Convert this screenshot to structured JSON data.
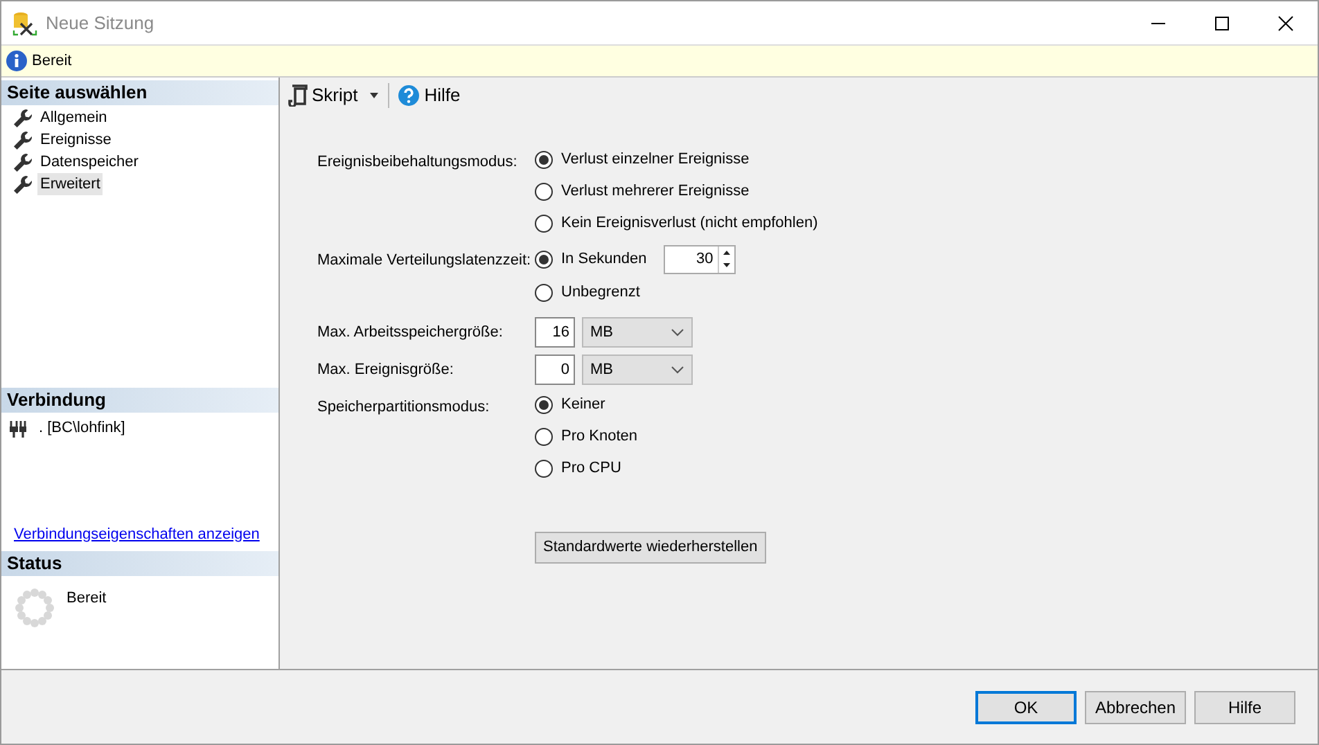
{
  "window": {
    "title": "Neue Sitzung"
  },
  "info_bar": {
    "text": "Bereit"
  },
  "sidebar": {
    "page_section": {
      "title": "Seite auswählen",
      "items": [
        {
          "label": "Allgemein",
          "selected": false
        },
        {
          "label": "Ereignisse",
          "selected": false
        },
        {
          "label": "Datenspeicher",
          "selected": false
        },
        {
          "label": "Erweitert",
          "selected": true
        }
      ]
    },
    "connection_section": {
      "title": "Verbindung",
      "server": ". [BC\\lohfink]",
      "link": "Verbindungseigenschaften anzeigen"
    },
    "status_section": {
      "title": "Status",
      "text": "Bereit"
    }
  },
  "toolbar": {
    "script_button": "Skript",
    "help_button": "Hilfe"
  },
  "settings": [
    {
      "kind": "radio-group",
      "label": "Ereignisbeibehaltungsmodus:",
      "options": [
        {
          "label": "Verlust einzelner Ereignisse",
          "selected": true
        },
        {
          "label": "Verlust mehrerer Ereignisse",
          "selected": false
        },
        {
          "label": "Kein Ereignisverlust (nicht empfohlen)",
          "selected": false
        }
      ]
    },
    {
      "kind": "radio-group",
      "label": "Maximale Verteilungslatenzzeit:",
      "options": [
        {
          "label": "In Sekunden",
          "selected": true,
          "spinner": "30"
        },
        {
          "label": "Unbegrenzt",
          "selected": false
        }
      ]
    },
    {
      "kind": "size",
      "label": "Max. Arbeitsspeichergröße:",
      "value": "16",
      "unit": "MB"
    },
    {
      "kind": "size",
      "label": "Max. Ereignisgröße:",
      "value": "0",
      "unit": "MB"
    },
    {
      "kind": "radio-group",
      "label": "Speicherpartitionsmodus:",
      "options": [
        {
          "label": "Keiner",
          "selected": true
        },
        {
          "label": "Pro Knoten",
          "selected": false
        },
        {
          "label": "Pro CPU",
          "selected": false
        }
      ]
    }
  ],
  "reset_button": "Standardwerte wiederherstellen",
  "footer_buttons": [
    {
      "label": "OK",
      "default": true
    },
    {
      "label": "Abbrechen",
      "default": false
    },
    {
      "label": "Hilfe",
      "default": false
    }
  ]
}
